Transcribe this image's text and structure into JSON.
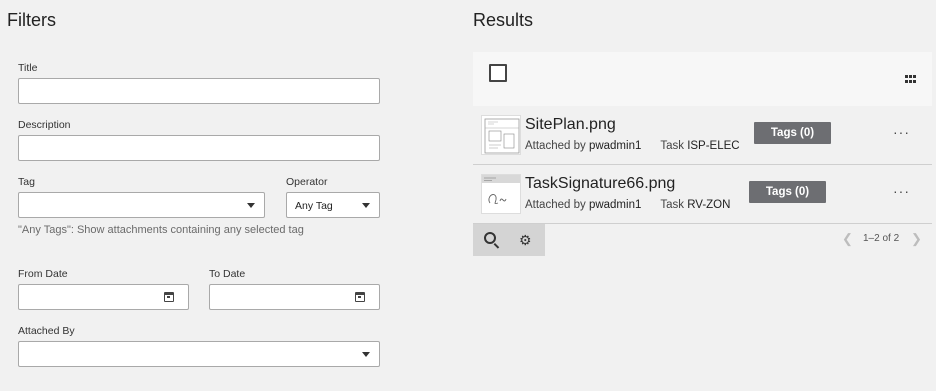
{
  "filters": {
    "heading": "Filters",
    "title_label": "Title",
    "title_value": "",
    "description_label": "Description",
    "description_value": "",
    "tag_label": "Tag",
    "tag_value": "",
    "operator_label": "Operator",
    "operator_value": "Any Tag",
    "hint": "\"Any Tags\": Show attachments containing any selected tag",
    "from_date_label": "From Date",
    "from_date_value": "",
    "to_date_label": "To Date",
    "to_date_value": "",
    "attached_by_label": "Attached By",
    "attached_by_value": ""
  },
  "results": {
    "heading": "Results",
    "items": [
      {
        "filename": "SitePlan.png",
        "attached_by_prefix": "Attached by",
        "user": "pwadmin1",
        "task_prefix": "Task",
        "task": "ISP-ELEC",
        "tags_label": "Tags (0)",
        "thumb_icon": "site-plan-thumbnail"
      },
      {
        "filename": "TaskSignature66.png",
        "attached_by_prefix": "Attached by",
        "user": "pwadmin1",
        "task_prefix": "Task",
        "task": "RV-ZON",
        "tags_label": "Tags (0)",
        "thumb_icon": "signature-thumbnail"
      }
    ],
    "more_label": "···",
    "pagination": "1–2 of 2"
  },
  "icons": {
    "select_all": "checkbox-icon",
    "view_toggle": "grid-icon",
    "search": "search-icon",
    "settings": "gears-icon",
    "prev": "chevron-left-icon",
    "next": "chevron-right-icon"
  },
  "colors": {
    "background": "#f1f1f1",
    "tags_button": "#6d6e72",
    "toolbar": "#f7f7f7",
    "footer_tools": "#d4d4d4"
  }
}
